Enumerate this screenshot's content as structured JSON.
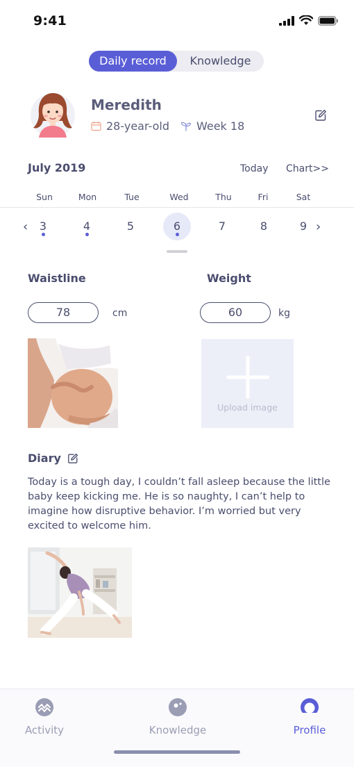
{
  "status": {
    "time": "9:41"
  },
  "tabs": {
    "daily_record": "Daily record",
    "knowledge": "Knowledge"
  },
  "profile": {
    "name": "Meredith",
    "age": "28-year-old",
    "week": "Week 18"
  },
  "calendar": {
    "month": "July 2019",
    "today_label": "Today",
    "chart_label": "Chart>>",
    "weekdays": [
      "Sun",
      "Mon",
      "Tue",
      "Wed",
      "Thu",
      "Fri",
      "Sat"
    ],
    "dates": [
      "3",
      "4",
      "5",
      "6",
      "7",
      "8",
      "9"
    ],
    "selected": "6"
  },
  "measurements": {
    "waistline_label": "Waistline",
    "waistline_value": "78",
    "waistline_unit": "cm",
    "weight_label": "Weight",
    "weight_value": "60",
    "weight_unit": "kg",
    "upload_label": "Upload image"
  },
  "diary": {
    "title": "Diary",
    "text": "Today is a tough day, I couldn’t fall asleep because the little baby keep kicking me. He is so naughty, I can’t help to imagine how disruptive behavior. I’m worried but very excited to welcome him."
  },
  "nav": {
    "activity": "Activity",
    "knowledge": "Knowledge",
    "profile": "Profile"
  },
  "colors": {
    "accent": "#5a5ed6",
    "text": "#4a4d6e",
    "inactive_nav": "#9a9db4",
    "upload_bg": "#eceff8"
  }
}
